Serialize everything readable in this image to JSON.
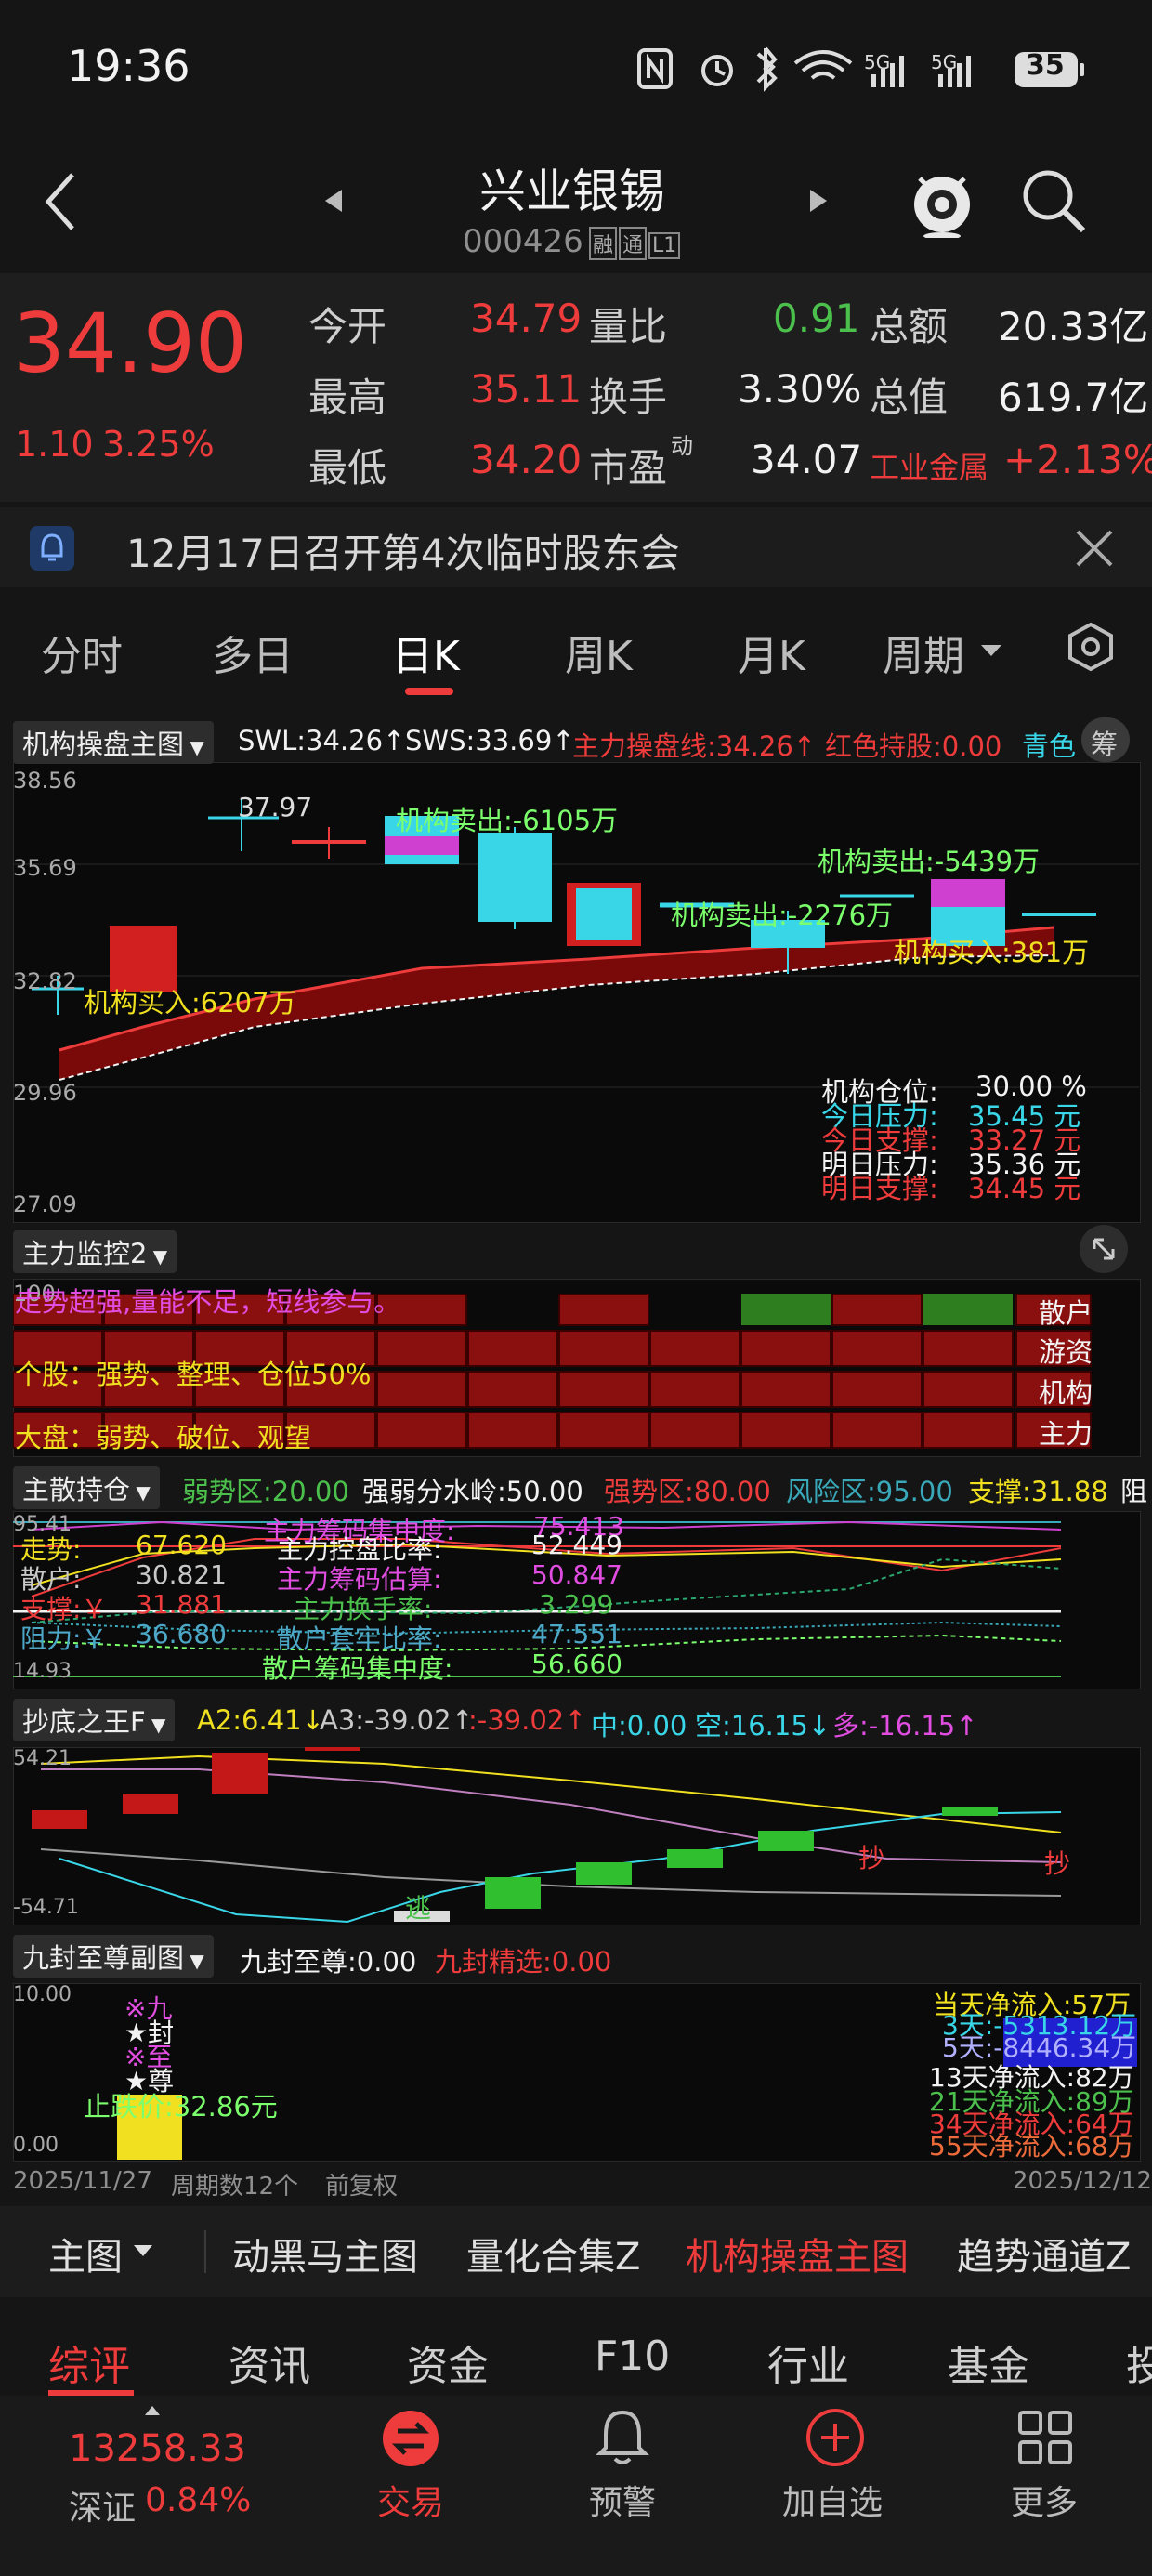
{
  "status_bar": {
    "time": "19:36",
    "battery": "35"
  },
  "header": {
    "title": "兴业银锡",
    "code": "000426",
    "badges": [
      "融",
      "通",
      "L1"
    ]
  },
  "quote": {
    "price": "34.90",
    "change": "1.10",
    "change_pct": "3.25%",
    "rows": [
      [
        {
          "label": "今开",
          "value": "34.79",
          "color": "#ee3b3b"
        },
        {
          "label": "量比",
          "value": "0.91",
          "color": "#4cc04c"
        },
        {
          "label": "总额",
          "value": "20.33亿",
          "color": "#f2f2f2"
        }
      ],
      [
        {
          "label": "最高",
          "value": "35.11",
          "color": "#ee3b3b"
        },
        {
          "label": "换手",
          "value": "3.30%",
          "color": "#f2f2f2"
        },
        {
          "label": "总值",
          "value": "619.7亿",
          "color": "#f2f2f2"
        }
      ],
      [
        {
          "label": "最低",
          "value": "34.20",
          "color": "#ee3b3b"
        },
        {
          "label": "市盈",
          "label_sup": "动",
          "value": "34.07",
          "color": "#f2f2f2"
        },
        {
          "label": "工业金属",
          "value": "+2.13%",
          "color": "#ee3b3b"
        }
      ]
    ]
  },
  "notice": {
    "text": "12月17日召开第4次临时股东会"
  },
  "chart_tabs": {
    "items": [
      "分时",
      "多日",
      "日K",
      "周K",
      "月K",
      "周期"
    ],
    "active": "日K"
  },
  "main_chart": {
    "selector": "机构操盘主图",
    "indicators": [
      {
        "text": "SWL:34.26↑",
        "color": "#f2f2f2"
      },
      {
        "text": "SWS:33.69↑",
        "color": "#f2f2f2"
      },
      {
        "text": "主力操盘线:34.26↑",
        "color": "#ee3b3b"
      },
      {
        "text": "红色持股:0.00",
        "color": "#ee3b3b"
      },
      {
        "text": "青色",
        "color": "#39d6e8"
      }
    ],
    "chip_label": "筹",
    "y_ticks": [
      "38.56",
      "35.69",
      "32.82",
      "29.96",
      "27.09"
    ],
    "high_mark": "37.97",
    "annotations": [
      {
        "text": "机构卖出:-6105万",
        "color": "#7cff6c"
      },
      {
        "text": "机构卖出:-5439万",
        "color": "#7cff6c"
      },
      {
        "text": "机构卖出:-2276万",
        "color": "#7cff6c"
      },
      {
        "text": "机构买入:381万",
        "color": "#f0e020"
      },
      {
        "text": "机构买入:6207万",
        "color": "#f0e020"
      }
    ],
    "info": [
      {
        "label": "机构仓位:",
        "value": "30.00 %",
        "color": "#f2f2f2"
      },
      {
        "label": "今日压力:",
        "value": "35.45 元",
        "color": "#39d6e8"
      },
      {
        "label": "今日支撑:",
        "value": "33.27 元",
        "color": "#ee3b3b"
      },
      {
        "label": "明日压力:",
        "value": "35.36 元",
        "color": "#f2f2f2"
      },
      {
        "label": "明日支撑:",
        "value": "34.45 元",
        "color": "#ee3b3b"
      }
    ]
  },
  "monitor": {
    "selector": "主力监控2",
    "tick": "100",
    "message": "走势超强,量能不足，短线参与。",
    "stock_line": "个股：强势、整理、仓位50%",
    "market_line": "大盘：弱势、破位、观望",
    "side_labels": [
      "散户",
      "游资",
      "机构",
      "主力"
    ]
  },
  "position": {
    "selector": "主散持仓",
    "indicators": [
      {
        "text": "弱势区:20.00",
        "color": "#4cc04c"
      },
      {
        "text": "强弱分水岭:50.00",
        "color": "#f2f2f2"
      },
      {
        "text": "强势区:80.00",
        "color": "#ee3b3b"
      },
      {
        "text": "风险区:95.00",
        "color": "#39a8b8"
      },
      {
        "text": "支撑:31.88",
        "color": "#f0e020"
      },
      {
        "text": "阻",
        "color": "#f2f2f2"
      }
    ],
    "y_top": "95.41",
    "y_bottom": "14.93",
    "col1": [
      {
        "label": "走势:",
        "value": "67.620",
        "color": "#f0e020"
      },
      {
        "label": "散户:",
        "value": "30.821",
        "color": "#c8c8c8"
      },
      {
        "label": "支撑:￥",
        "value": "31.881",
        "color": "#ee3b3b"
      },
      {
        "label": "阻力:￥",
        "value": "36.680",
        "color": "#4da8c8"
      }
    ],
    "col2": [
      {
        "label": "主力筹码集中度:",
        "value": "75.413",
        "color": "#e04de0"
      },
      {
        "label": "主力控盘比率:",
        "value": "52.449",
        "color": "#f2f2f2"
      },
      {
        "label": "主力筹码估算:",
        "value": "50.847",
        "color": "#e04de0"
      },
      {
        "label": "主力换手率:",
        "value": "3.299",
        "color": "#4cc04c"
      },
      {
        "label": "散户套牢比率:",
        "value": "47.551",
        "color": "#4da8c8"
      },
      {
        "label": "散户筹码集中度:",
        "value": "56.660",
        "color": "#7cff6c"
      }
    ]
  },
  "bottom_finder": {
    "selector": "抄底之王F",
    "indicators": [
      {
        "text": "A2:6.41↓",
        "color": "#f0e020"
      },
      {
        "text": "A3:-39.02↑",
        "color": "#c8c8c8"
      },
      {
        "text": ":-39.02↑",
        "color": "#ee3b3b"
      },
      {
        "text": "中:0.00",
        "color": "#39d6e8"
      },
      {
        "text": "空:16.15↓",
        "color": "#39d6e8"
      },
      {
        "text": "多:-16.15↑",
        "color": "#e04de0"
      }
    ],
    "y_top": "54.21",
    "y_bottom": "-54.71",
    "marks": [
      "抄",
      "抄",
      "逃"
    ]
  },
  "nine_seal": {
    "selector": "九封至尊副图",
    "indicators": [
      {
        "text": "九封至尊:0.00",
        "color": "#f2f2f2"
      },
      {
        "text": "九封精选:0.00",
        "color": "#ee3b3b"
      }
    ],
    "y_top": "10.00",
    "y_bottom": "0.00",
    "vertical_marks": [
      "※九",
      "★封",
      "※至",
      "★尊"
    ],
    "stop_label": "止跌价:32.86元",
    "flows": [
      {
        "text": "当天净流入:57万",
        "color": "#f0e020"
      },
      {
        "text": "3天:-5313.12万",
        "color": "#39d6e8"
      },
      {
        "text": "5天:-8446.34万",
        "color": "#6a6aff"
      },
      {
        "text": "13天净流入:82万",
        "color": "#f2f2f2"
      },
      {
        "text": "21天净流入:89万",
        "color": "#4cc04c"
      },
      {
        "text": "34天净流入:64万",
        "color": "#ee3b3b"
      },
      {
        "text": "55天净流入:68万",
        "color": "#ee3b3b"
      }
    ]
  },
  "date_bar": {
    "start": "2025/11/27",
    "period": "周期数12个",
    "adjust": "前复权",
    "end": "2025/12/12"
  },
  "indicator_tabs": {
    "selector": "主图",
    "items": [
      "动黑马主图",
      "量化合集Z",
      "机构操盘主图",
      "趋势通道Z"
    ],
    "active": "机构操盘主图"
  },
  "info_tabs": {
    "items": [
      "综评",
      "资讯",
      "资金",
      "F10",
      "行业",
      "基金",
      "投"
    ],
    "active": "综评"
  },
  "bottom_nav": {
    "index_value": "13258.33",
    "index_name": "深证",
    "index_change": "0.84%",
    "items": [
      "交易",
      "预警",
      "加自选",
      "更多"
    ]
  }
}
